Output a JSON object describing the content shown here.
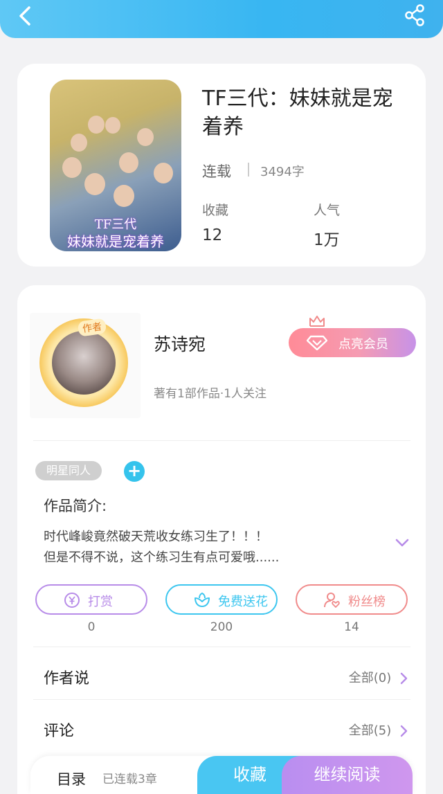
{
  "book": {
    "title": "TF三代：妹妹就是宠着养",
    "cover_caption_1": "TF三代",
    "cover_caption_2": "妹妹就是宠着养",
    "status": "连载",
    "word_count": "3494字",
    "stats": [
      {
        "label": "收藏",
        "value": "12"
      },
      {
        "label": "人气",
        "value": "1万"
      }
    ]
  },
  "author": {
    "badge": "作者",
    "name": "苏诗宛",
    "meta": "著有1部作品·1人关注",
    "vip_button": "点亮会员"
  },
  "tags": [
    "明星同人"
  ],
  "tag_add": "+",
  "intro": {
    "label": "作品简介:",
    "lines": [
      "时代峰峻竟然破天荒收女练习生了！！！",
      "但是不得不说，这个练习生有点可爱哦......"
    ]
  },
  "actions": [
    {
      "label": "打赏",
      "count": "0",
      "color": "#b78be8"
    },
    {
      "label": "免费送花",
      "count": "200",
      "color": "#3cc6ef"
    },
    {
      "label": "粉丝榜",
      "count": "14",
      "color": "#f08a8a"
    }
  ],
  "sections": [
    {
      "label": "作者说",
      "link": "全部(0)"
    },
    {
      "label": "评论",
      "link": "全部(5)"
    }
  ],
  "bottom": {
    "toc": "目录",
    "chapters": "已连载3章",
    "favorite": "收藏",
    "continue": "继续阅读"
  },
  "colors": {
    "header": "#38b6f2",
    "accent_blue": "#49c6f2",
    "accent_purple": "#b98ef0",
    "chevron": "#b78be8"
  }
}
